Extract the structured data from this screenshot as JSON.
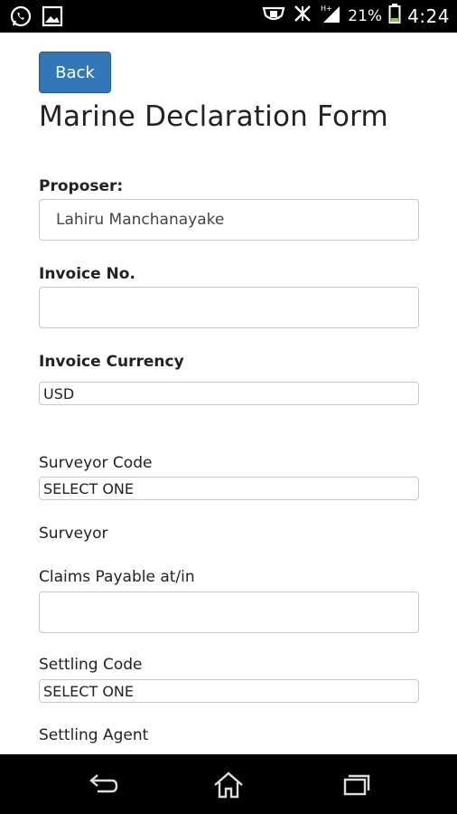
{
  "status_bar": {
    "battery_percent": "21%",
    "time": "4:24",
    "icons": [
      "whatsapp-icon",
      "gallery-icon",
      "vpn-icon",
      "vibrate-off-icon",
      "signal-icon",
      "battery-icon"
    ]
  },
  "back_label": "Back",
  "title": "Marine Declaration Form",
  "form": {
    "proposer_label": "Proposer:",
    "proposer_value": "Lahiru Manchanayake",
    "invoice_no_label": "Invoice No.",
    "invoice_no_value": "",
    "invoice_currency_label": "Invoice Currency",
    "invoice_currency_value": "USD",
    "surveyor_code_label": "Surveyor Code",
    "surveyor_code_value": "SELECT ONE",
    "surveyor_label": "Surveyor",
    "claims_payable_label": "Claims Payable at/in",
    "claims_payable_value": "",
    "settling_code_label": "Settling Code",
    "settling_code_value": "SELECT ONE",
    "settling_agent_label": "Settling Agent"
  },
  "nav": {
    "icons": [
      "back-icon",
      "home-icon",
      "recents-icon"
    ]
  }
}
